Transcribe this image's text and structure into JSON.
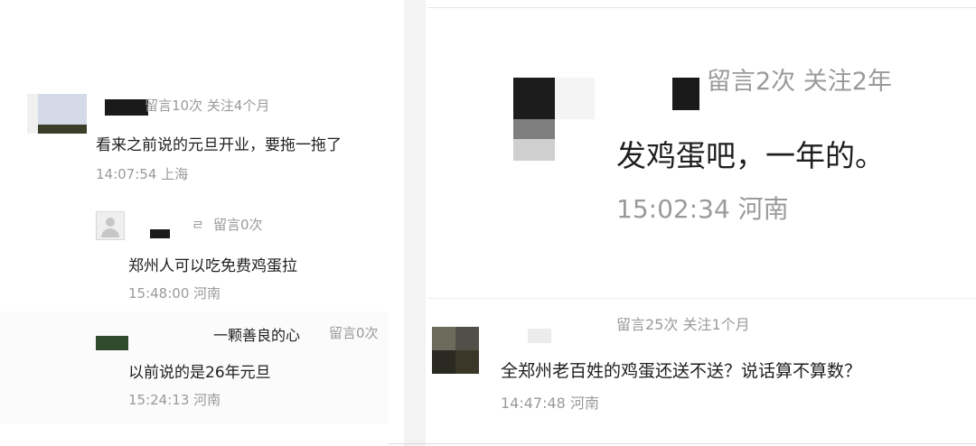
{
  "left": {
    "c1": {
      "meta": "留言10次 关注4个月",
      "text": "看来之前说的元旦开业，要拖一拖了",
      "time_loc": "14:07:54 上海"
    },
    "r1": {
      "name_tail": "ㄹ",
      "meta": "留言0次",
      "text": "郑州人可以吃免费鸡蛋拉",
      "time_loc": "15:48:00 河南"
    },
    "r2": {
      "name": "一颗善良的心",
      "meta": "留言0次",
      "text": "以前说的是26年元旦",
      "time_loc": "15:24:13 河南"
    }
  },
  "right": {
    "c1": {
      "meta": "留言2次 关注2年",
      "text": "发鸡蛋吧，一年的。",
      "time_loc": "15:02:34 河南"
    },
    "c2": {
      "meta": "留言25次 关注1个月",
      "text": "全郑州老百姓的鸡蛋还送不送？说话算不算数？",
      "time_loc": "14:47:48 河南"
    }
  }
}
